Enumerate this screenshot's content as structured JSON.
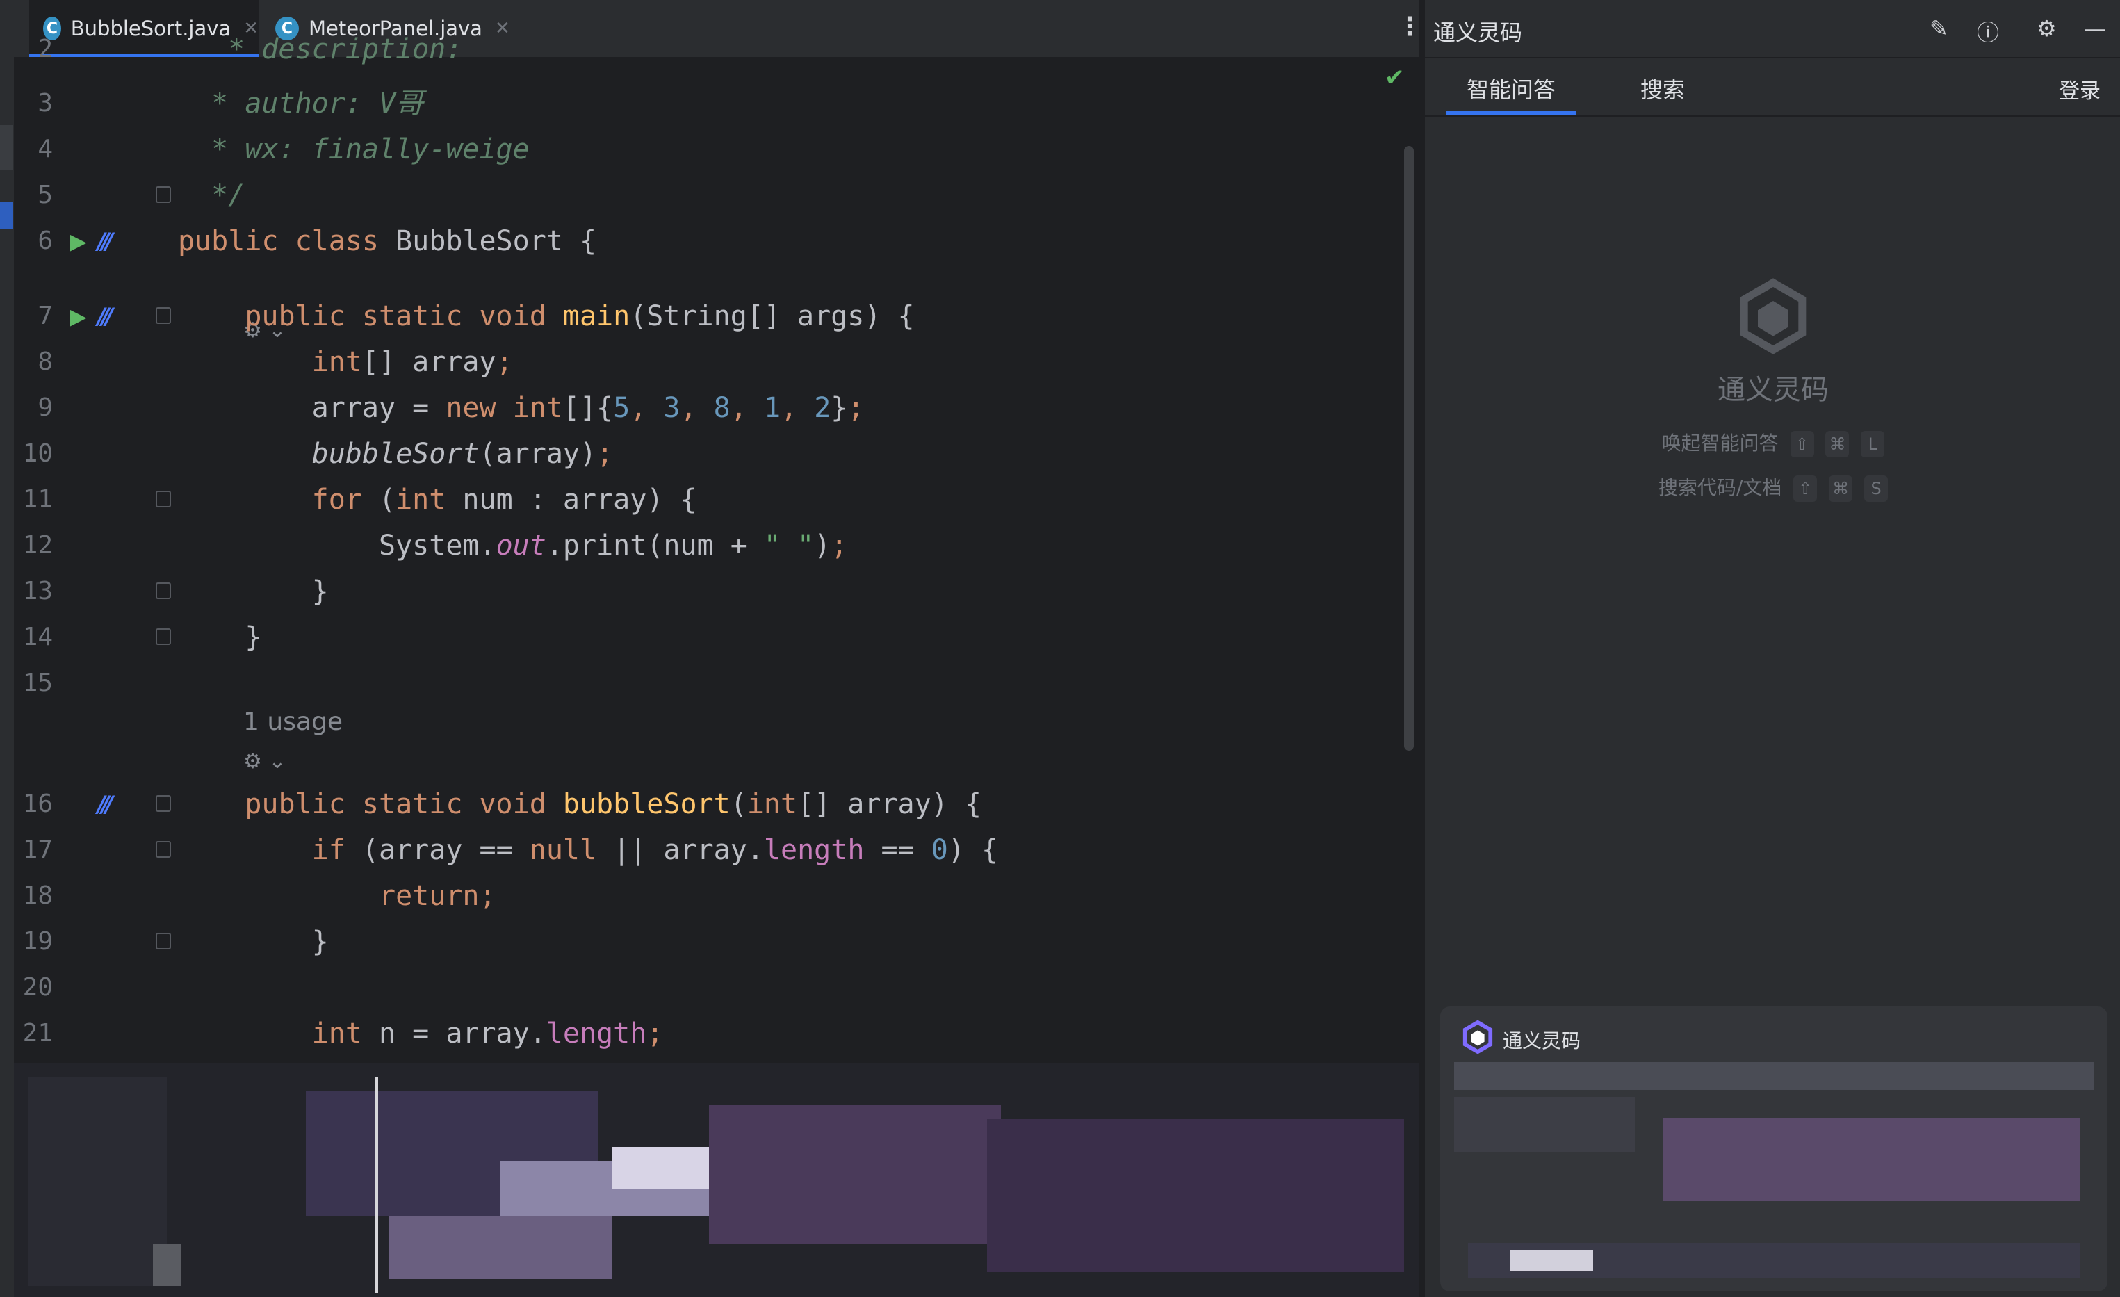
{
  "tabs": [
    {
      "label": "BubbleSort.java",
      "icon": "C",
      "active": true
    },
    {
      "label": "MeteorPanel.java",
      "icon": "C",
      "active": false
    }
  ],
  "editor": {
    "hints": {
      "usage": "1 usage"
    },
    "lines": [
      {
        "num": "2",
        "code": "  * description:"
      },
      {
        "num": "3",
        "code": "  * author: V哥"
      },
      {
        "num": "4",
        "code": "  * wx: finally-weige"
      },
      {
        "num": "5",
        "code": "  */"
      },
      {
        "num": "6",
        "code": "public class BubbleSort {"
      },
      {
        "num": "7",
        "code": "    public static void main(String[] args) {"
      },
      {
        "num": "8",
        "code": "        int[] array;"
      },
      {
        "num": "9",
        "code": "        array = new int[]{5, 3, 8, 1, 2};"
      },
      {
        "num": "10",
        "code": "        bubbleSort(array);"
      },
      {
        "num": "11",
        "code": "        for (int num : array) {"
      },
      {
        "num": "12",
        "code": "            System.out.print(num + \" \");"
      },
      {
        "num": "13",
        "code": "        }"
      },
      {
        "num": "14",
        "code": "    }"
      },
      {
        "num": "15",
        "code": ""
      },
      {
        "num": "16",
        "code": "    public static void bubbleSort(int[] array) {"
      },
      {
        "num": "17",
        "code": "        if (array == null || array.length == 0) {"
      },
      {
        "num": "18",
        "code": "            return;"
      },
      {
        "num": "19",
        "code": "        }"
      },
      {
        "num": "20",
        "code": ""
      },
      {
        "num": "21",
        "code": "        int n = array.length;"
      }
    ]
  },
  "panel": {
    "title": "通义灵码",
    "tabs": [
      "智能问答",
      "搜索"
    ],
    "login": "登录",
    "brand_name": "通义灵码",
    "shortcuts": [
      {
        "label": "唤起智能问答",
        "keys": [
          "⇧",
          "⌘",
          "L"
        ]
      },
      {
        "label": "搜索代码/文档",
        "keys": [
          "⇧",
          "⌘",
          "S"
        ]
      }
    ],
    "notice_title": "通义灵码"
  },
  "colors": {
    "accent": "#3574f0",
    "keyword": "#cf8e6d",
    "comment": "#5f826b",
    "number": "#6897bb",
    "function": "#ffc66d",
    "field": "#c77dbb",
    "string": "#6aab73"
  }
}
